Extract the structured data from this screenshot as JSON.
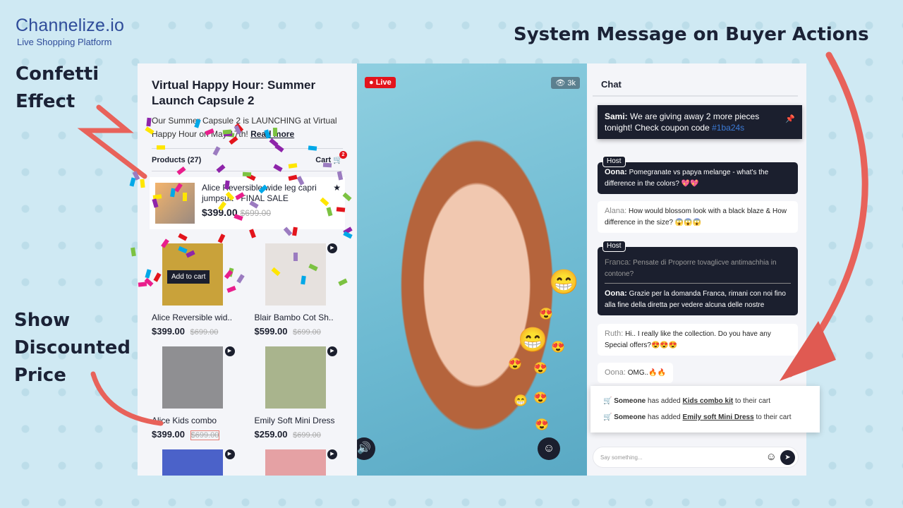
{
  "logo": {
    "name": "Channelize.io",
    "tagline": "Live Shopping Platform"
  },
  "callouts": {
    "confetti": "Confetti Effect",
    "discount": "Show Discounted Price",
    "system": "System Message on Buyer Actions"
  },
  "event": {
    "title": "Virtual Happy Hour: Summer Launch Capsule 2",
    "description": "Our Summer Capsule 2 is LAUNCHING at Virtual Happy Hour on May 17th!",
    "read_more": "Read more"
  },
  "products_bar": {
    "products_label": "Products (27)",
    "cart_label": "Cart",
    "cart_count": "2"
  },
  "featured": {
    "name": "Alice Reversible wide leg capri jumpsuit - FINAL SALE",
    "price": "$399.00",
    "old_price": "$699.00"
  },
  "products": [
    {
      "name": "Alice Reversible wid..",
      "price": "$399.00",
      "old_price": "$699.00",
      "overlay": "Add to cart",
      "color": "#c9a23a"
    },
    {
      "name": "Blair Bambo Cot Sh..",
      "price": "$599.00",
      "old_price": "$699.00",
      "color": "#e6e1de"
    },
    {
      "name": "Alice Kids combo",
      "price": "$399.00",
      "old_price": "$699.00",
      "color": "#8f8f92"
    },
    {
      "name": "Emily Soft Mini Dress",
      "price": "$259.00",
      "old_price": "$699.00",
      "color": "#a9b48d"
    },
    {
      "color": "#4b62c9"
    },
    {
      "color": "#e5a1a4"
    }
  ],
  "video": {
    "live_label": "Live",
    "views": "3k"
  },
  "chat": {
    "title": "Chat",
    "pinned": {
      "author": "Sami:",
      "text": "We are giving away 2 more pieces tonight! Check coupon code",
      "code": "#1ba24s"
    },
    "host_label": "Host",
    "messages": [
      {
        "author": "Oona:",
        "text": "Pomegranate vs papya melange - what's the difference in the colors? 💖💖"
      },
      {
        "author": "Alana:",
        "text": "How would blossom look with a black blaze & How difference in the size? 😱😱😱"
      },
      {
        "quote_author": "Franca:",
        "quote_text": "Pensate di Proporre tovaglicve antimachhia in contone?",
        "author": "Oona:",
        "text": "Grazie per la domanda Franca, rimani con noi fino alla fine della diretta per vedere alcuna delle nostre"
      },
      {
        "author": "Ruth:",
        "text": "Hi.. I really like the collection. Do you have any Special offers?😍😍😍"
      },
      {
        "author": "Oona:",
        "text": "OMG..🔥🔥"
      }
    ],
    "system": [
      {
        "who": "Someone",
        "mid": "has added",
        "item": "Kids combo kit",
        "end": "to their cart"
      },
      {
        "who": "Someone",
        "mid": "has added",
        "item": "Emily soft Mini Dress",
        "end": "to their cart"
      }
    ],
    "input_placeholder": "Say something..."
  },
  "colors": {
    "accent": "#1b1f2e",
    "live": "#e3141c",
    "arrow": "#e8625a",
    "background": "#cfe9f3"
  }
}
